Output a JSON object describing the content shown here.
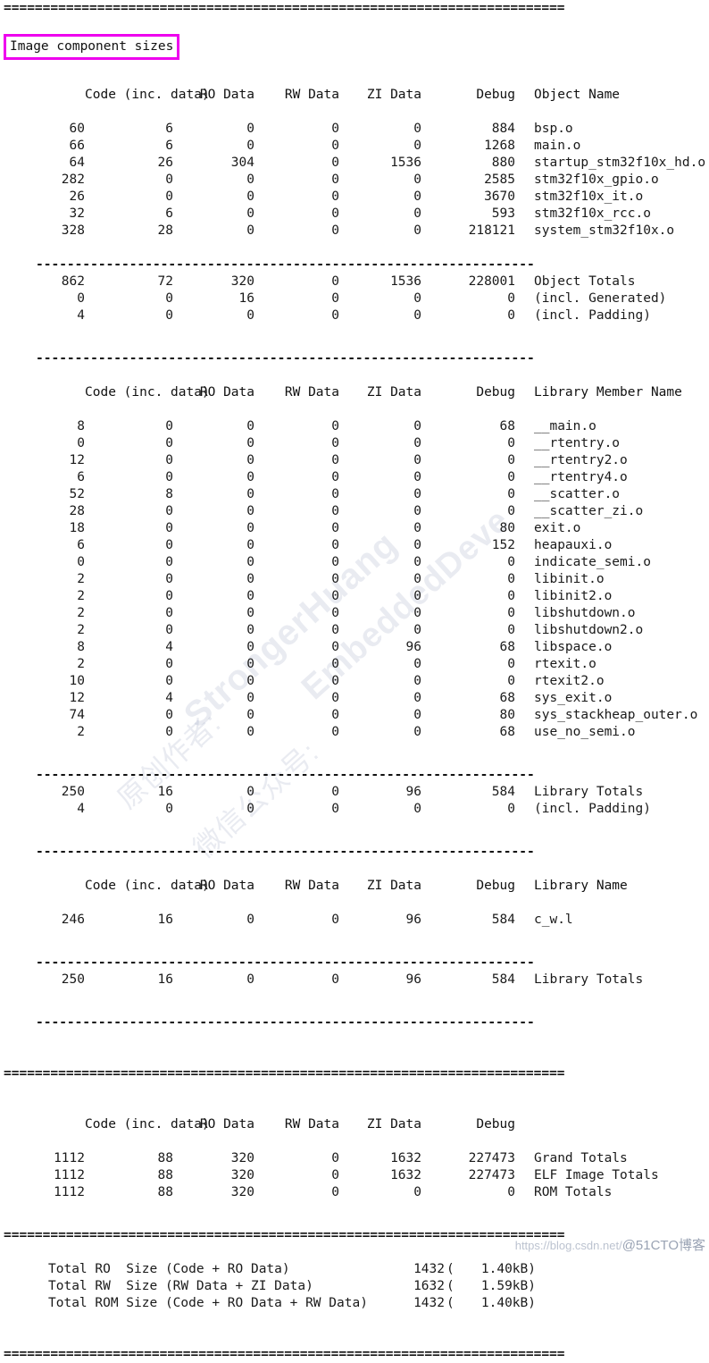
{
  "title": "Image component sizes",
  "accent_color": "#ee00ee",
  "rules": {
    "equals_long": "========================================================================",
    "equals_short": "====================================================================",
    "dashes": "----------------------------------------------------------------"
  },
  "columns": {
    "code": "Code (inc. data)",
    "ro_data": "RO Data",
    "rw_data": "RW Data",
    "zi_data": "ZI Data",
    "debug": "Debug",
    "object_name": "Object Name",
    "library_member_name": "Library Member Name",
    "library_name": "Library Name"
  },
  "objects": {
    "header_name": "Object Name",
    "rows": [
      {
        "code": "60",
        "inc_data": "6",
        "ro": "0",
        "rw": "0",
        "zi": "0",
        "debug": "884",
        "name": "bsp.o"
      },
      {
        "code": "66",
        "inc_data": "6",
        "ro": "0",
        "rw": "0",
        "zi": "0",
        "debug": "1268",
        "name": "main.o"
      },
      {
        "code": "64",
        "inc_data": "26",
        "ro": "304",
        "rw": "0",
        "zi": "1536",
        "debug": "880",
        "name": "startup_stm32f10x_hd.o"
      },
      {
        "code": "282",
        "inc_data": "0",
        "ro": "0",
        "rw": "0",
        "zi": "0",
        "debug": "2585",
        "name": "stm32f10x_gpio.o"
      },
      {
        "code": "26",
        "inc_data": "0",
        "ro": "0",
        "rw": "0",
        "zi": "0",
        "debug": "3670",
        "name": "stm32f10x_it.o"
      },
      {
        "code": "32",
        "inc_data": "6",
        "ro": "0",
        "rw": "0",
        "zi": "0",
        "debug": "593",
        "name": "stm32f10x_rcc.o"
      },
      {
        "code": "328",
        "inc_data": "28",
        "ro": "0",
        "rw": "0",
        "zi": "0",
        "debug": "218121",
        "name": "system_stm32f10x.o"
      }
    ],
    "totals": [
      {
        "code": "862",
        "inc_data": "72",
        "ro": "320",
        "rw": "0",
        "zi": "1536",
        "debug": "228001",
        "name": "Object Totals"
      },
      {
        "code": "0",
        "inc_data": "0",
        "ro": "16",
        "rw": "0",
        "zi": "0",
        "debug": "0",
        "name": "(incl. Generated)"
      },
      {
        "code": "4",
        "inc_data": "0",
        "ro": "0",
        "rw": "0",
        "zi": "0",
        "debug": "0",
        "name": "(incl. Padding)"
      }
    ]
  },
  "library_members": {
    "header_name": "Library Member Name",
    "rows": [
      {
        "code": "8",
        "inc_data": "0",
        "ro": "0",
        "rw": "0",
        "zi": "0",
        "debug": "68",
        "name": "__main.o"
      },
      {
        "code": "0",
        "inc_data": "0",
        "ro": "0",
        "rw": "0",
        "zi": "0",
        "debug": "0",
        "name": "__rtentry.o"
      },
      {
        "code": "12",
        "inc_data": "0",
        "ro": "0",
        "rw": "0",
        "zi": "0",
        "debug": "0",
        "name": "__rtentry2.o"
      },
      {
        "code": "6",
        "inc_data": "0",
        "ro": "0",
        "rw": "0",
        "zi": "0",
        "debug": "0",
        "name": "__rtentry4.o"
      },
      {
        "code": "52",
        "inc_data": "8",
        "ro": "0",
        "rw": "0",
        "zi": "0",
        "debug": "0",
        "name": "__scatter.o"
      },
      {
        "code": "28",
        "inc_data": "0",
        "ro": "0",
        "rw": "0",
        "zi": "0",
        "debug": "0",
        "name": "__scatter_zi.o"
      },
      {
        "code": "18",
        "inc_data": "0",
        "ro": "0",
        "rw": "0",
        "zi": "0",
        "debug": "80",
        "name": "exit.o"
      },
      {
        "code": "6",
        "inc_data": "0",
        "ro": "0",
        "rw": "0",
        "zi": "0",
        "debug": "152",
        "name": "heapauxi.o"
      },
      {
        "code": "0",
        "inc_data": "0",
        "ro": "0",
        "rw": "0",
        "zi": "0",
        "debug": "0",
        "name": "indicate_semi.o"
      },
      {
        "code": "2",
        "inc_data": "0",
        "ro": "0",
        "rw": "0",
        "zi": "0",
        "debug": "0",
        "name": "libinit.o"
      },
      {
        "code": "2",
        "inc_data": "0",
        "ro": "0",
        "rw": "0",
        "zi": "0",
        "debug": "0",
        "name": "libinit2.o"
      },
      {
        "code": "2",
        "inc_data": "0",
        "ro": "0",
        "rw": "0",
        "zi": "0",
        "debug": "0",
        "name": "libshutdown.o"
      },
      {
        "code": "2",
        "inc_data": "0",
        "ro": "0",
        "rw": "0",
        "zi": "0",
        "debug": "0",
        "name": "libshutdown2.o"
      },
      {
        "code": "8",
        "inc_data": "4",
        "ro": "0",
        "rw": "0",
        "zi": "96",
        "debug": "68",
        "name": "libspace.o"
      },
      {
        "code": "2",
        "inc_data": "0",
        "ro": "0",
        "rw": "0",
        "zi": "0",
        "debug": "0",
        "name": "rtexit.o"
      },
      {
        "code": "10",
        "inc_data": "0",
        "ro": "0",
        "rw": "0",
        "zi": "0",
        "debug": "0",
        "name": "rtexit2.o"
      },
      {
        "code": "12",
        "inc_data": "4",
        "ro": "0",
        "rw": "0",
        "zi": "0",
        "debug": "68",
        "name": "sys_exit.o"
      },
      {
        "code": "74",
        "inc_data": "0",
        "ro": "0",
        "rw": "0",
        "zi": "0",
        "debug": "80",
        "name": "sys_stackheap_outer.o"
      },
      {
        "code": "2",
        "inc_data": "0",
        "ro": "0",
        "rw": "0",
        "zi": "0",
        "debug": "68",
        "name": "use_no_semi.o"
      }
    ],
    "totals": [
      {
        "code": "250",
        "inc_data": "16",
        "ro": "0",
        "rw": "0",
        "zi": "96",
        "debug": "584",
        "name": "Library Totals"
      },
      {
        "code": "4",
        "inc_data": "0",
        "ro": "0",
        "rw": "0",
        "zi": "0",
        "debug": "0",
        "name": "(incl. Padding)"
      }
    ]
  },
  "libraries": {
    "header_name": "Library Name",
    "rows": [
      {
        "code": "246",
        "inc_data": "16",
        "ro": "0",
        "rw": "0",
        "zi": "96",
        "debug": "584",
        "name": "c_w.l"
      }
    ],
    "totals": [
      {
        "code": "250",
        "inc_data": "16",
        "ro": "0",
        "rw": "0",
        "zi": "96",
        "debug": "584",
        "name": "Library Totals"
      }
    ]
  },
  "grand": {
    "rows": [
      {
        "code": "1112",
        "inc_data": "88",
        "ro": "320",
        "rw": "0",
        "zi": "1632",
        "debug": "227473",
        "name": "Grand Totals"
      },
      {
        "code": "1112",
        "inc_data": "88",
        "ro": "320",
        "rw": "0",
        "zi": "1632",
        "debug": "227473",
        "name": "ELF Image Totals"
      },
      {
        "code": "1112",
        "inc_data": "88",
        "ro": "320",
        "rw": "0",
        "zi": "0",
        "debug": "0",
        "name": "ROM Totals"
      }
    ]
  },
  "summary": [
    {
      "label": "Total RO  Size (Code + RO Data)",
      "bytes": "1432",
      "kb": "1.40kB)"
    },
    {
      "label": "Total RW  Size (RW Data + ZI Data)",
      "bytes": "1632",
      "kb": "1.59kB)"
    },
    {
      "label": "Total ROM Size (Code + RO Data + RW Data)",
      "bytes": "1432",
      "kb": "1.40kB)"
    }
  ],
  "watermark": {
    "line1": "StrongerHuang",
    "line2": "EmbeddedDeve",
    "line3": "原创作者:",
    "line4": "微信公众号:"
  },
  "footer": {
    "blog_url": "https://blog.csdn.net/",
    "credit": "@51CTO博客"
  }
}
